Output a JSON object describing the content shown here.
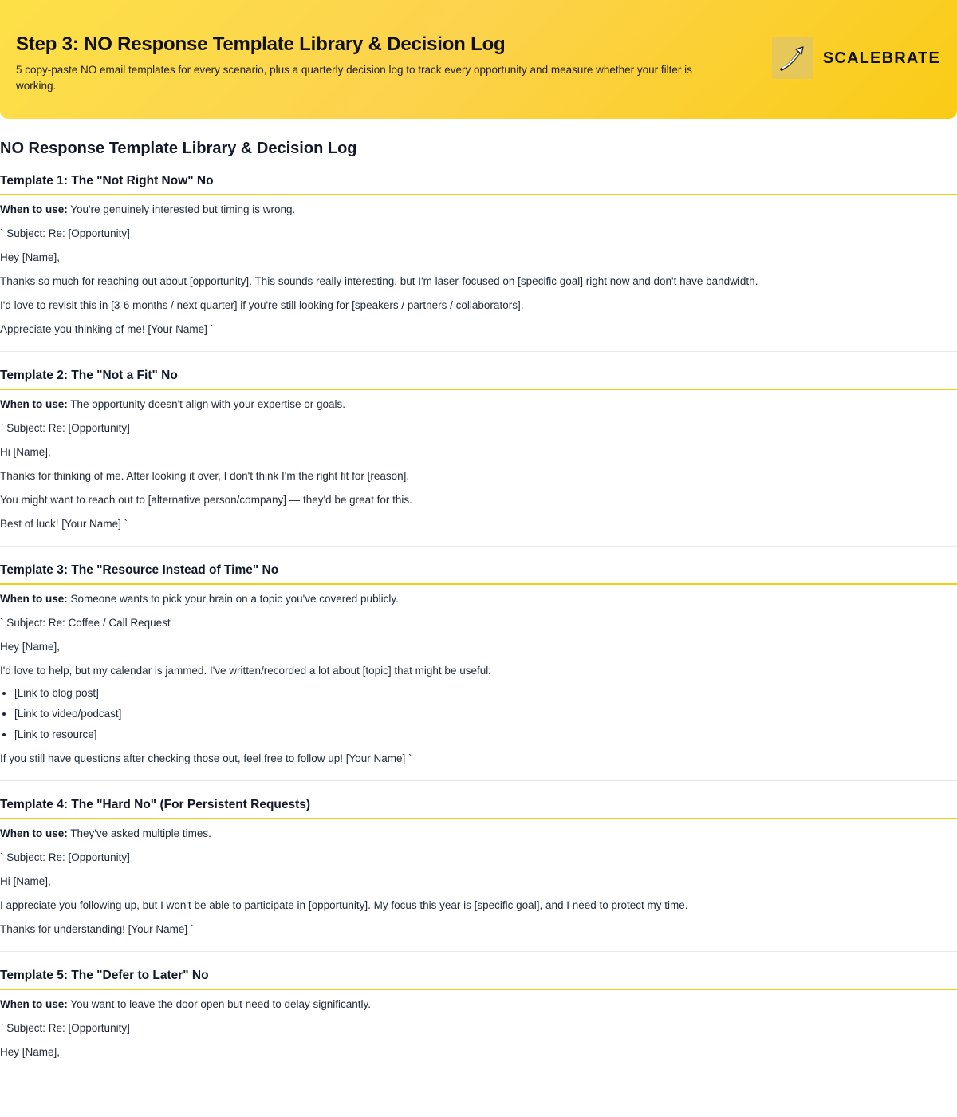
{
  "header": {
    "title": "Step 3: NO Response Template Library & Decision Log",
    "subtitle": "5 copy-paste NO email templates for every scenario, plus a quarterly decision log to track every opportunity and measure whether your filter is working.",
    "brand_name": "SCALEBRATE",
    "brand_logo_icon": "upward-arrow-icon",
    "accent_color": "#facc15"
  },
  "doc_title": "NO Response Template Library & Decision Log",
  "when_label": "When to use:",
  "templates": [
    {
      "title": "Template 1: The \"Not Right Now\" No",
      "when": "You're genuinely interested but timing is wrong.",
      "lines": [
        "` Subject: Re: [Opportunity]",
        "Hey [Name],",
        "Thanks so much for reaching out about [opportunity]. This sounds really interesting, but I'm laser-focused on [specific goal] right now and don't have bandwidth.",
        "I'd love to revisit this in [3-6 months / next quarter] if you're still looking for [speakers / partners / collaborators].",
        "Appreciate you thinking of me! [Your Name] `"
      ]
    },
    {
      "title": "Template 2: The \"Not a Fit\" No",
      "when": "The opportunity doesn't align with your expertise or goals.",
      "lines": [
        "` Subject: Re: [Opportunity]",
        "Hi [Name],",
        "Thanks for thinking of me. After looking it over, I don't think I'm the right fit for [reason].",
        "You might want to reach out to [alternative person/company] — they'd be great for this.",
        "Best of luck! [Your Name] `"
      ]
    },
    {
      "title": "Template 3: The \"Resource Instead of Time\" No",
      "when": "Someone wants to pick your brain on a topic you've covered publicly.",
      "lines": [
        "` Subject: Re: Coffee / Call Request",
        "Hey [Name],",
        "I'd love to help, but my calendar is jammed. I've written/recorded a lot about [topic] that might be useful:"
      ],
      "bullets": [
        "[Link to blog post]",
        "[Link to video/podcast]",
        "[Link to resource]"
      ],
      "closing": "If you still have questions after checking those out, feel free to follow up! [Your Name] `"
    },
    {
      "title": "Template 4: The \"Hard No\" (For Persistent Requests)",
      "when": "They've asked multiple times.",
      "lines": [
        "` Subject: Re: [Opportunity]",
        "Hi [Name],",
        "I appreciate you following up, but I won't be able to participate in [opportunity]. My focus this year is [specific goal], and I need to protect my time.",
        "Thanks for understanding! [Your Name] `"
      ]
    },
    {
      "title": "Template 5: The \"Defer to Later\" No",
      "when": "You want to leave the door open but need to delay significantly.",
      "lines": [
        "` Subject: Re: [Opportunity]",
        "Hey [Name],"
      ]
    }
  ]
}
